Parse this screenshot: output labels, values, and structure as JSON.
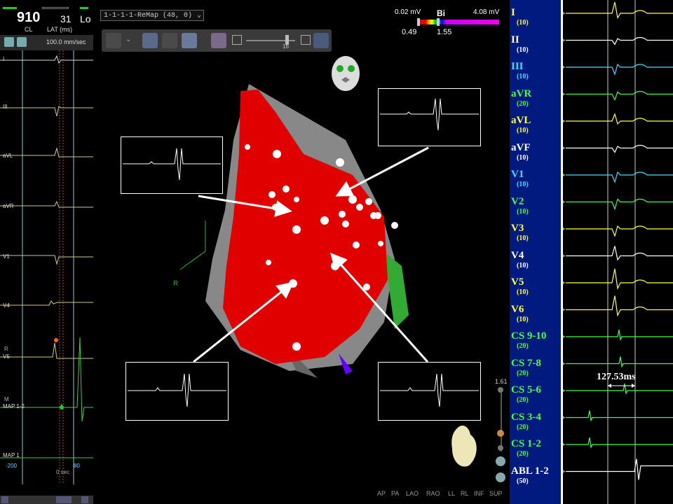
{
  "left_panel": {
    "cycle_length": "910",
    "cycle_length_label": "CL",
    "lat_value": "31",
    "lat_label": "LAT (ms)",
    "lat_extra": "Lo",
    "sweep_speed": "100.0 mm/sec",
    "leads": [
      "I",
      "III",
      "aVL",
      "aVR",
      "V1",
      "V4",
      "V5",
      "MAP 1-2",
      "MAP 1"
    ],
    "marker_r": "R",
    "marker_m": "M",
    "axis_left": "-200",
    "axis_mid": "0 sec",
    "axis_right": "80"
  },
  "map_panel": {
    "map_name": "1-1-1-1-ReMap (48, 0)",
    "slider_value": "16",
    "scale_low": "0.02 mV",
    "scale_mode": "Bi",
    "scale_high": "4.08 mV",
    "threshold_low": "0.49",
    "threshold_high": "1.55",
    "axis_label": "R",
    "side_scale_value": "1.61",
    "view_buttons": [
      "AP",
      "PA",
      "LAO",
      "RAO",
      "LL",
      "RL",
      "INF",
      "SUP"
    ],
    "colors": {
      "scar": "#e00000",
      "toolbar": "#3a3a3a"
    }
  },
  "right_panel": {
    "channels": [
      {
        "name": "I",
        "gain": "(10)",
        "color": "#ffff44"
      },
      {
        "name": "II",
        "gain": "(10)",
        "color": "#ffffff"
      },
      {
        "name": "III",
        "gain": "(10)",
        "color": "#44ddff"
      },
      {
        "name": "aVR",
        "gain": "(20)",
        "color": "#44ff44"
      },
      {
        "name": "aVL",
        "gain": "(10)",
        "color": "#ffff44"
      },
      {
        "name": "aVF",
        "gain": "(10)",
        "color": "#ffffff"
      },
      {
        "name": "V1",
        "gain": "(10)",
        "color": "#44ddff"
      },
      {
        "name": "V2",
        "gain": "(10)",
        "color": "#44ff44"
      },
      {
        "name": "V3",
        "gain": "(10)",
        "color": "#ffff44"
      },
      {
        "name": "V4",
        "gain": "(10)",
        "color": "#ffffff"
      },
      {
        "name": "V5",
        "gain": "(10)",
        "color": "#ffff44"
      },
      {
        "name": "V6",
        "gain": "(10)",
        "color": "#ffff44"
      },
      {
        "name": "CS 9-10",
        "gain": "(20)",
        "color": "#44ff44"
      },
      {
        "name": "CS 7-8",
        "gain": "(20)",
        "color": "#44ff44"
      },
      {
        "name": "CS 5-6",
        "gain": "(20)",
        "color": "#44ff44"
      },
      {
        "name": "CS 3-4",
        "gain": "(20)",
        "color": "#44ff44"
      },
      {
        "name": "CS 1-2",
        "gain": "(20)",
        "color": "#44ff44"
      },
      {
        "name": "ABL 1-2",
        "gain": "(50)",
        "color": "#ffffff"
      }
    ],
    "interval": "127.53ms"
  }
}
